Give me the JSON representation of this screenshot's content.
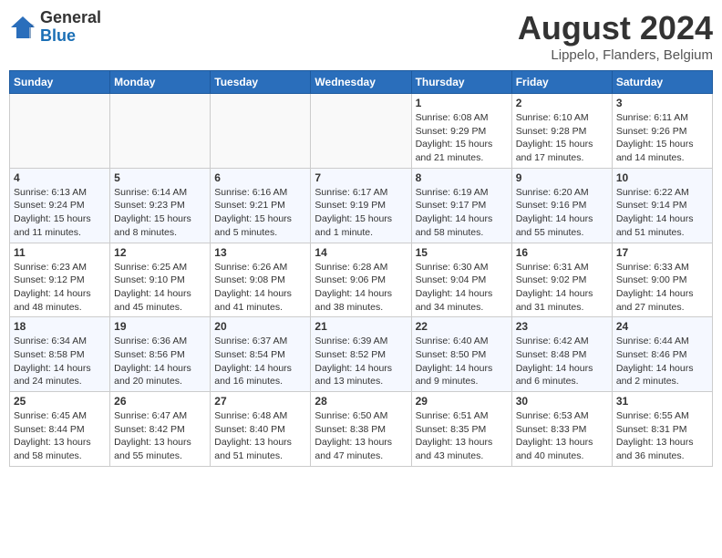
{
  "header": {
    "logo_line1": "General",
    "logo_line2": "Blue",
    "month_year": "August 2024",
    "location": "Lippelo, Flanders, Belgium"
  },
  "weekdays": [
    "Sunday",
    "Monday",
    "Tuesday",
    "Wednesday",
    "Thursday",
    "Friday",
    "Saturday"
  ],
  "weeks": [
    [
      {
        "day": "",
        "info": ""
      },
      {
        "day": "",
        "info": ""
      },
      {
        "day": "",
        "info": ""
      },
      {
        "day": "",
        "info": ""
      },
      {
        "day": "1",
        "info": "Sunrise: 6:08 AM\nSunset: 9:29 PM\nDaylight: 15 hours and 21 minutes."
      },
      {
        "day": "2",
        "info": "Sunrise: 6:10 AM\nSunset: 9:28 PM\nDaylight: 15 hours and 17 minutes."
      },
      {
        "day": "3",
        "info": "Sunrise: 6:11 AM\nSunset: 9:26 PM\nDaylight: 15 hours and 14 minutes."
      }
    ],
    [
      {
        "day": "4",
        "info": "Sunrise: 6:13 AM\nSunset: 9:24 PM\nDaylight: 15 hours and 11 minutes."
      },
      {
        "day": "5",
        "info": "Sunrise: 6:14 AM\nSunset: 9:23 PM\nDaylight: 15 hours and 8 minutes."
      },
      {
        "day": "6",
        "info": "Sunrise: 6:16 AM\nSunset: 9:21 PM\nDaylight: 15 hours and 5 minutes."
      },
      {
        "day": "7",
        "info": "Sunrise: 6:17 AM\nSunset: 9:19 PM\nDaylight: 15 hours and 1 minute."
      },
      {
        "day": "8",
        "info": "Sunrise: 6:19 AM\nSunset: 9:17 PM\nDaylight: 14 hours and 58 minutes."
      },
      {
        "day": "9",
        "info": "Sunrise: 6:20 AM\nSunset: 9:16 PM\nDaylight: 14 hours and 55 minutes."
      },
      {
        "day": "10",
        "info": "Sunrise: 6:22 AM\nSunset: 9:14 PM\nDaylight: 14 hours and 51 minutes."
      }
    ],
    [
      {
        "day": "11",
        "info": "Sunrise: 6:23 AM\nSunset: 9:12 PM\nDaylight: 14 hours and 48 minutes."
      },
      {
        "day": "12",
        "info": "Sunrise: 6:25 AM\nSunset: 9:10 PM\nDaylight: 14 hours and 45 minutes."
      },
      {
        "day": "13",
        "info": "Sunrise: 6:26 AM\nSunset: 9:08 PM\nDaylight: 14 hours and 41 minutes."
      },
      {
        "day": "14",
        "info": "Sunrise: 6:28 AM\nSunset: 9:06 PM\nDaylight: 14 hours and 38 minutes."
      },
      {
        "day": "15",
        "info": "Sunrise: 6:30 AM\nSunset: 9:04 PM\nDaylight: 14 hours and 34 minutes."
      },
      {
        "day": "16",
        "info": "Sunrise: 6:31 AM\nSunset: 9:02 PM\nDaylight: 14 hours and 31 minutes."
      },
      {
        "day": "17",
        "info": "Sunrise: 6:33 AM\nSunset: 9:00 PM\nDaylight: 14 hours and 27 minutes."
      }
    ],
    [
      {
        "day": "18",
        "info": "Sunrise: 6:34 AM\nSunset: 8:58 PM\nDaylight: 14 hours and 24 minutes."
      },
      {
        "day": "19",
        "info": "Sunrise: 6:36 AM\nSunset: 8:56 PM\nDaylight: 14 hours and 20 minutes."
      },
      {
        "day": "20",
        "info": "Sunrise: 6:37 AM\nSunset: 8:54 PM\nDaylight: 14 hours and 16 minutes."
      },
      {
        "day": "21",
        "info": "Sunrise: 6:39 AM\nSunset: 8:52 PM\nDaylight: 14 hours and 13 minutes."
      },
      {
        "day": "22",
        "info": "Sunrise: 6:40 AM\nSunset: 8:50 PM\nDaylight: 14 hours and 9 minutes."
      },
      {
        "day": "23",
        "info": "Sunrise: 6:42 AM\nSunset: 8:48 PM\nDaylight: 14 hours and 6 minutes."
      },
      {
        "day": "24",
        "info": "Sunrise: 6:44 AM\nSunset: 8:46 PM\nDaylight: 14 hours and 2 minutes."
      }
    ],
    [
      {
        "day": "25",
        "info": "Sunrise: 6:45 AM\nSunset: 8:44 PM\nDaylight: 13 hours and 58 minutes."
      },
      {
        "day": "26",
        "info": "Sunrise: 6:47 AM\nSunset: 8:42 PM\nDaylight: 13 hours and 55 minutes."
      },
      {
        "day": "27",
        "info": "Sunrise: 6:48 AM\nSunset: 8:40 PM\nDaylight: 13 hours and 51 minutes."
      },
      {
        "day": "28",
        "info": "Sunrise: 6:50 AM\nSunset: 8:38 PM\nDaylight: 13 hours and 47 minutes."
      },
      {
        "day": "29",
        "info": "Sunrise: 6:51 AM\nSunset: 8:35 PM\nDaylight: 13 hours and 43 minutes."
      },
      {
        "day": "30",
        "info": "Sunrise: 6:53 AM\nSunset: 8:33 PM\nDaylight: 13 hours and 40 minutes."
      },
      {
        "day": "31",
        "info": "Sunrise: 6:55 AM\nSunset: 8:31 PM\nDaylight: 13 hours and 36 minutes."
      }
    ]
  ]
}
